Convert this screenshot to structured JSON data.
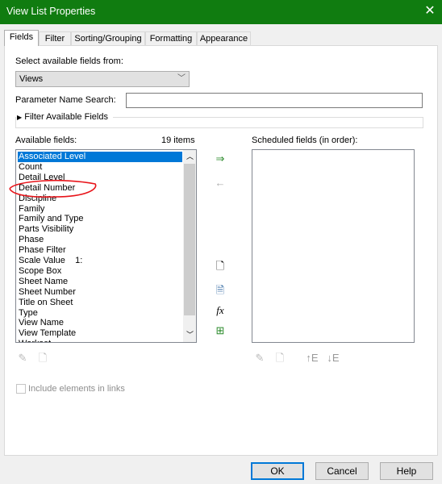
{
  "window": {
    "title": "View List Properties",
    "close": "✕"
  },
  "tabs": [
    {
      "label": "Fields"
    },
    {
      "label": "Filter"
    },
    {
      "label": "Sorting/Grouping"
    },
    {
      "label": "Formatting"
    },
    {
      "label": "Appearance"
    }
  ],
  "fields": {
    "select_from_label": "Select available fields from:",
    "select_from_value": "Views",
    "param_search_label": "Parameter Name Search:",
    "param_search_value": "",
    "filter_available_label": "Filter Available Fields",
    "available_label": "Available fields:",
    "item_count": "19 items",
    "available_items": [
      "Associated Level",
      "Count",
      "Detail Level",
      "Detail Number",
      "Discipline",
      "Family",
      "Family and Type",
      "Parts Visibility",
      "Phase",
      "Phase Filter",
      "Scale Value    1:",
      "Scope Box",
      "Sheet Name",
      "Sheet Number",
      "Title on Sheet",
      "Type",
      "View Name",
      "View Template",
      "Workset"
    ],
    "selected_item": "Associated Level",
    "scheduled_label": "Scheduled fields (in order):",
    "include_links_label": "Include elements in links",
    "include_links_checked": false
  },
  "icons": {
    "formula": "fx",
    "move_up": "↑E",
    "move_down": "↓E"
  },
  "annotation_color": "#e8141a",
  "accent": "#107c10",
  "buttons": {
    "ok": "OK",
    "cancel": "Cancel",
    "help": "Help"
  }
}
